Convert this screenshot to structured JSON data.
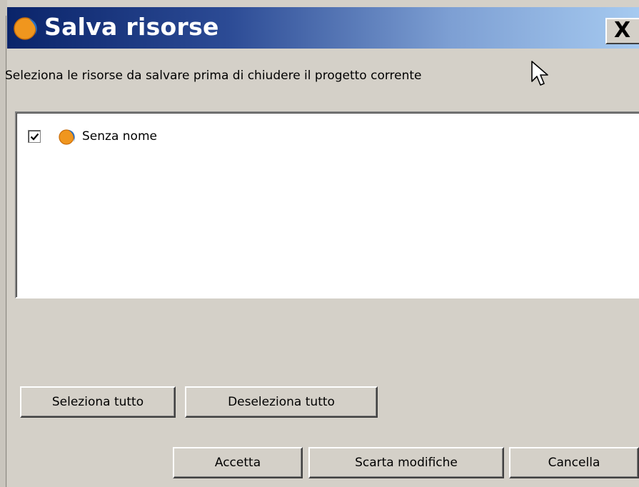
{
  "window": {
    "title": "Salva risorse",
    "close_label": "X",
    "app_icon": "sis-globe-icon"
  },
  "dialog": {
    "instruction": "Seleziona le risorse da salvare prima di chiudere il progetto corrente"
  },
  "resources": [
    {
      "label": "Senza nome",
      "checked": true,
      "icon": "sis-globe-icon"
    }
  ],
  "buttons": {
    "select_all": "Seleziona tutto",
    "deselect_all": "Deseleziona tutto",
    "accept": "Accetta",
    "discard": "Scarta modifiche",
    "cancel": "Cancella"
  },
  "colors": {
    "titlebar_start": "#0a246a",
    "titlebar_end": "#a6caf0",
    "dialog_bg": "#d4d0c8",
    "icon_orange": "#f0961e",
    "icon_blue": "#2a6fc0"
  }
}
